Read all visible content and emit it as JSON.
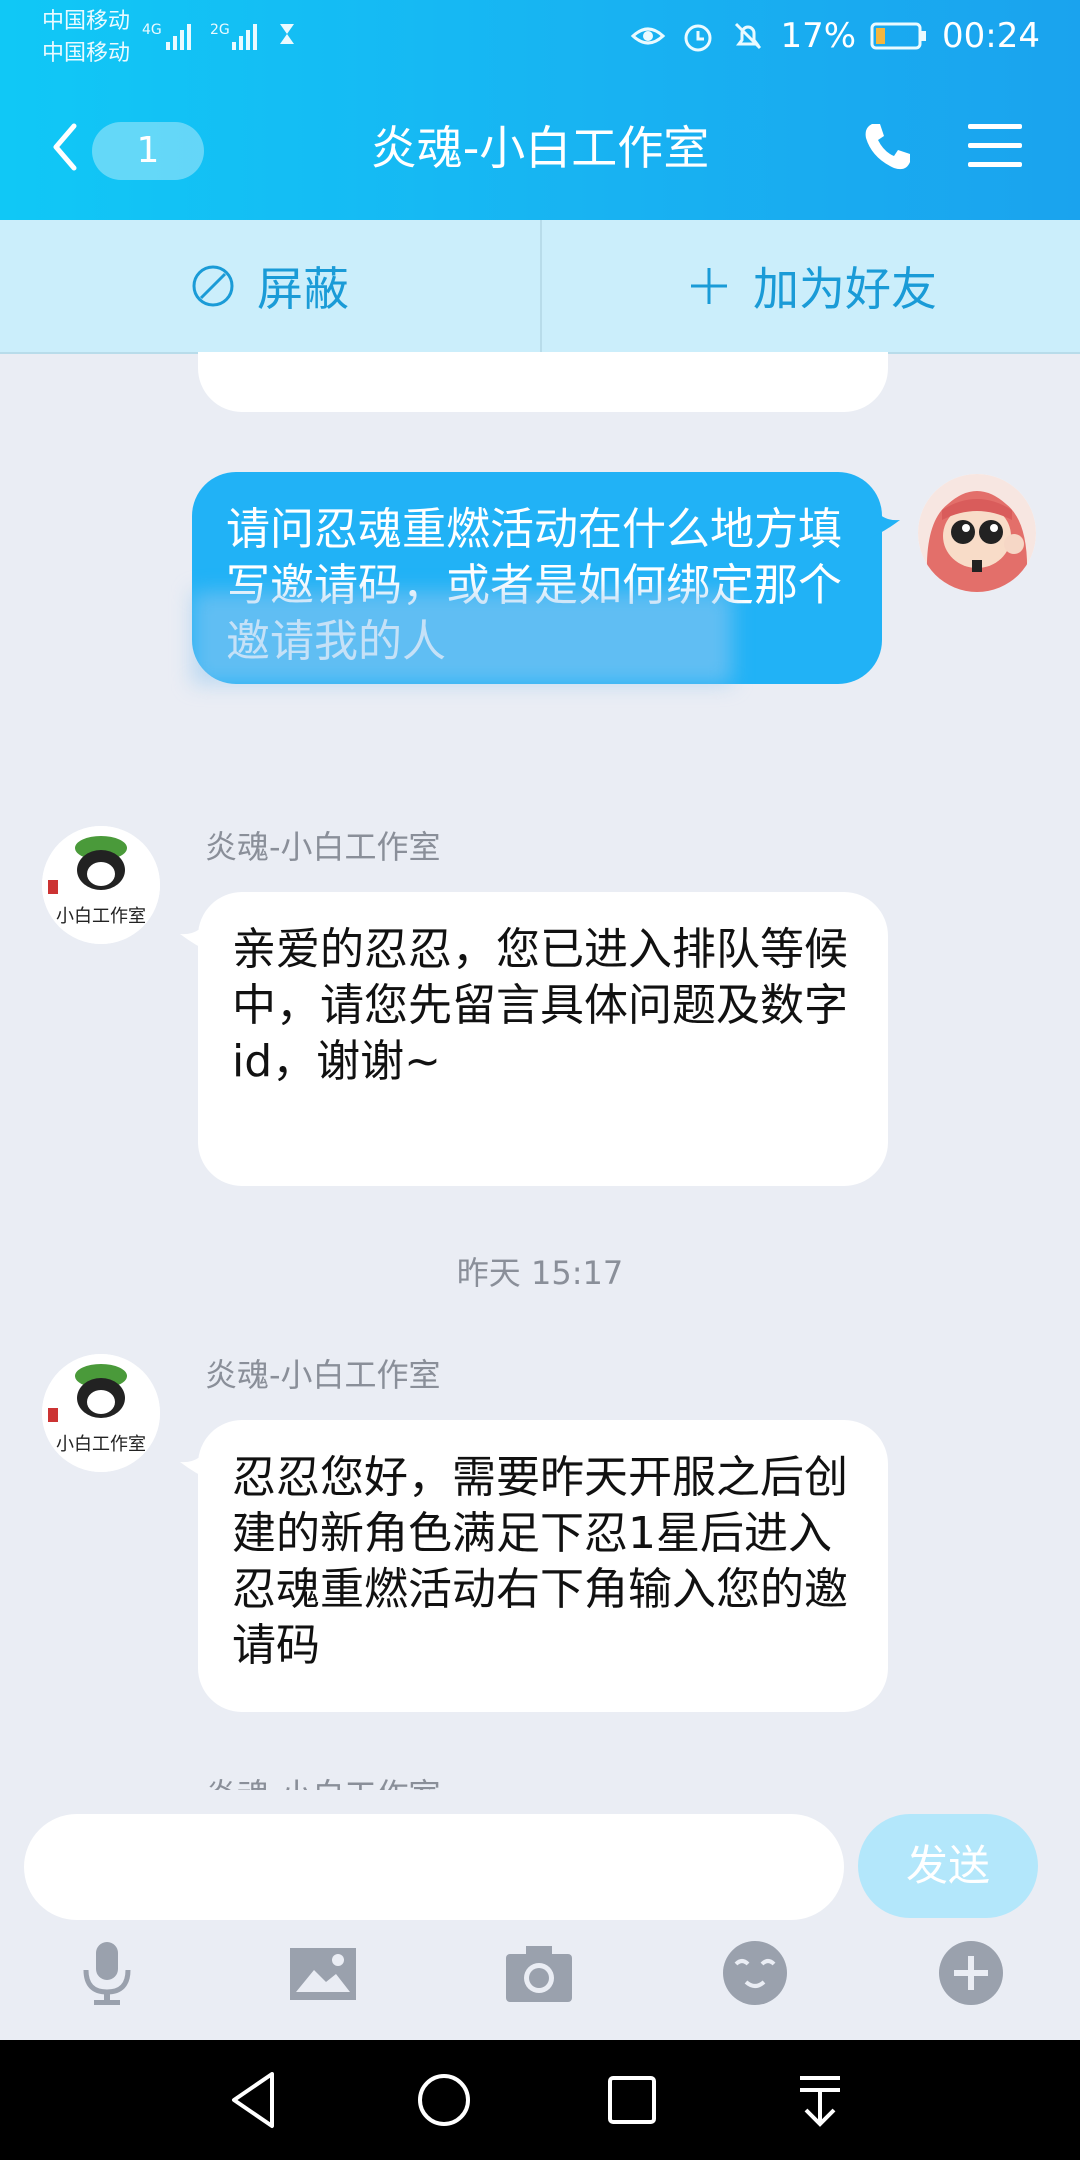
{
  "status_bar": {
    "carrier_1": "中国移动",
    "carrier_2": "中国移动",
    "net_1": "4G",
    "net_2": "2G",
    "battery": "17%",
    "time": "00:24"
  },
  "header": {
    "unread_count": "1",
    "title": "炎魂-小白工作室",
    "icons": [
      "back-icon",
      "phone-icon",
      "menu-icon"
    ]
  },
  "action_bar": {
    "block_label": "屏蔽",
    "add_friend_label": "加为好友"
  },
  "messages": [
    {
      "type": "outgoing",
      "text": "请问忍魂重燃活动在什么地方填写邀请码，或者是如何绑定那个邀请我的人"
    },
    {
      "type": "incoming",
      "sender": "炎魂-小白工作室",
      "text": "亲爱的忍忍，您已进入排队等候中，请您先留言具体问题及数字id，谢谢~"
    },
    {
      "type": "time",
      "text": "昨天 15:17"
    },
    {
      "type": "incoming",
      "sender": "炎魂-小白工作室",
      "text": "忍忍您好，需要昨天开服之后创建的新角色满足下忍1星后进入忍魂重燃活动右下角输入您的邀请码"
    },
    {
      "type": "incoming-partial",
      "sender": "炎魂-小白工作室"
    }
  ],
  "avatar_label": "小白工作室",
  "composer": {
    "send_label": "发送",
    "tools": [
      "microphone-icon",
      "image-icon",
      "camera-icon",
      "emoji-icon",
      "plus-icon"
    ]
  },
  "colors": {
    "header_gradient_start": "#10c8f6",
    "header_gradient_end": "#1aa3ee",
    "outgoing_bubble": "#21b2f6",
    "chat_background": "#eaedf4",
    "action_bar": "#cbeefb"
  }
}
